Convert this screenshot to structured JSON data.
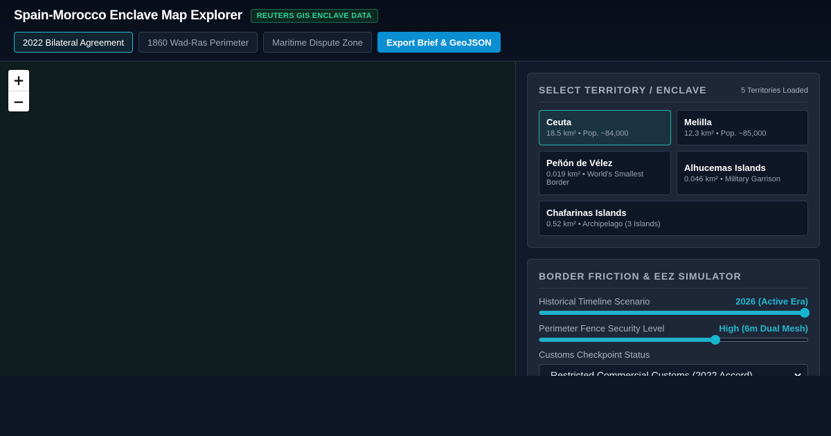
{
  "header": {
    "title": "Spain-Morocco Enclave Map Explorer",
    "badge": "REUTERS GIS ENCLAVE DATA",
    "toolbar": {
      "bilateral_label": "2022 Bilateral Agreement",
      "perimeter_label": "1860 Wad-Ras Perimeter",
      "maritime_label": "Maritime Dispute Zone",
      "export_label": "Export Brief & GeoJSON"
    }
  },
  "map": {
    "zoom_in": "+",
    "zoom_out": "−"
  },
  "territory_panel": {
    "title": "Select Territory / Enclave",
    "count": "5 Territories Loaded",
    "items": [
      {
        "name": "Ceuta",
        "detail": "18.5 km² • Pop. ~84,000"
      },
      {
        "name": "Melilla",
        "detail": "12.3 km² • Pop. ~85,000"
      },
      {
        "name": "Peñón de Vélez",
        "detail": "0.019 km² • World's Smallest Border"
      },
      {
        "name": "Alhucemas Islands",
        "detail": "0.046 km² • Military Garrison"
      },
      {
        "name": "Chafarinas Islands",
        "detail": "0.52 km² • Archipelago (3 Islands)"
      }
    ],
    "selected": "Ceuta"
  },
  "simulator": {
    "title": "Border Friction & EEZ Simulator",
    "timeline": {
      "label": "Historical Timeline Scenario",
      "value": "2026 (Active Era)",
      "fraction": 1.0
    },
    "fence": {
      "label": "Perimeter Fence Security Level",
      "value": "High (6m Dual Mesh)",
      "fraction": 0.66
    },
    "customs": {
      "label": "Customs Checkpoint Status",
      "selected": "Restricted Commercial Customs (2022 Accord)"
    }
  },
  "colors": {
    "accent": "#22b8cf",
    "badge": "#34d399",
    "export_button": "#0b8fd3"
  }
}
